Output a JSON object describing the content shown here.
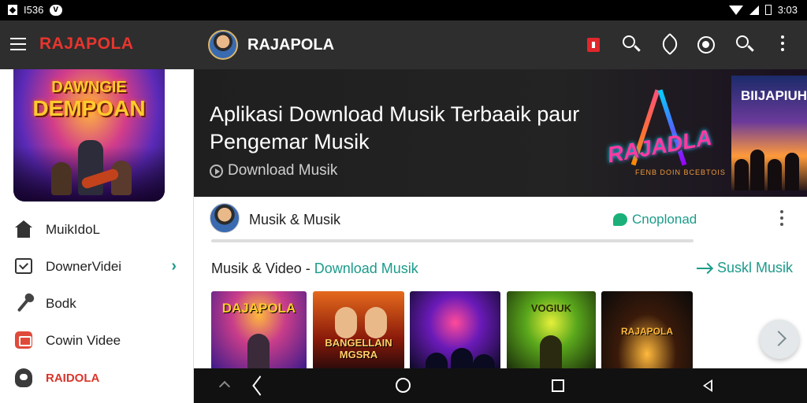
{
  "status_bar": {
    "left_text": "I536",
    "time": "3:03"
  },
  "drawer": {
    "brand": "RAJAPOLA",
    "art": {
      "line1": "DAWNGIE",
      "line2": "DEMPOAN"
    },
    "items": [
      {
        "label": "MuikIdoL",
        "icon": "home-icon"
      },
      {
        "label": "DownerVidei",
        "icon": "checkbox-icon",
        "has_chevron": true
      },
      {
        "label": "Bodk",
        "icon": "microphone-icon"
      },
      {
        "label": "Cowin Videe",
        "icon": "video-icon"
      },
      {
        "label": "RAIDOLA",
        "icon": "skull-icon"
      }
    ]
  },
  "appbar": {
    "title": "RAJAPOLA",
    "icons": [
      "record-icon",
      "search-icon",
      "tool-icon",
      "gamepad-icon",
      "search-icon",
      "more-icon"
    ]
  },
  "hero": {
    "title": "Aplikasi Download Musik Terbaaik paur Pengemar Musik",
    "subtitle": "Download Musik",
    "logo_text": "RAJADLA",
    "logo_sub": "FENB DOIN BCEBTOIS",
    "poster_text": "BIIJAPIUH"
  },
  "channel": {
    "name": "Musik & Musik",
    "action": "Cnoplonad"
  },
  "section": {
    "title": "Musik & Video - ",
    "title_link": "Download Musik",
    "right_link": "Suskl Musik"
  },
  "thumbnails": [
    {
      "text": "DAJAPOLA"
    },
    {
      "text": "BANGELLAIN MGSRA"
    },
    {
      "text": ""
    },
    {
      "text": "VOGIUK"
    },
    {
      "text": "RAJAPOLA"
    }
  ],
  "colors": {
    "accent": "#1b9b8a",
    "brand": "#e8352d",
    "appbar": "#2e2e2e"
  }
}
